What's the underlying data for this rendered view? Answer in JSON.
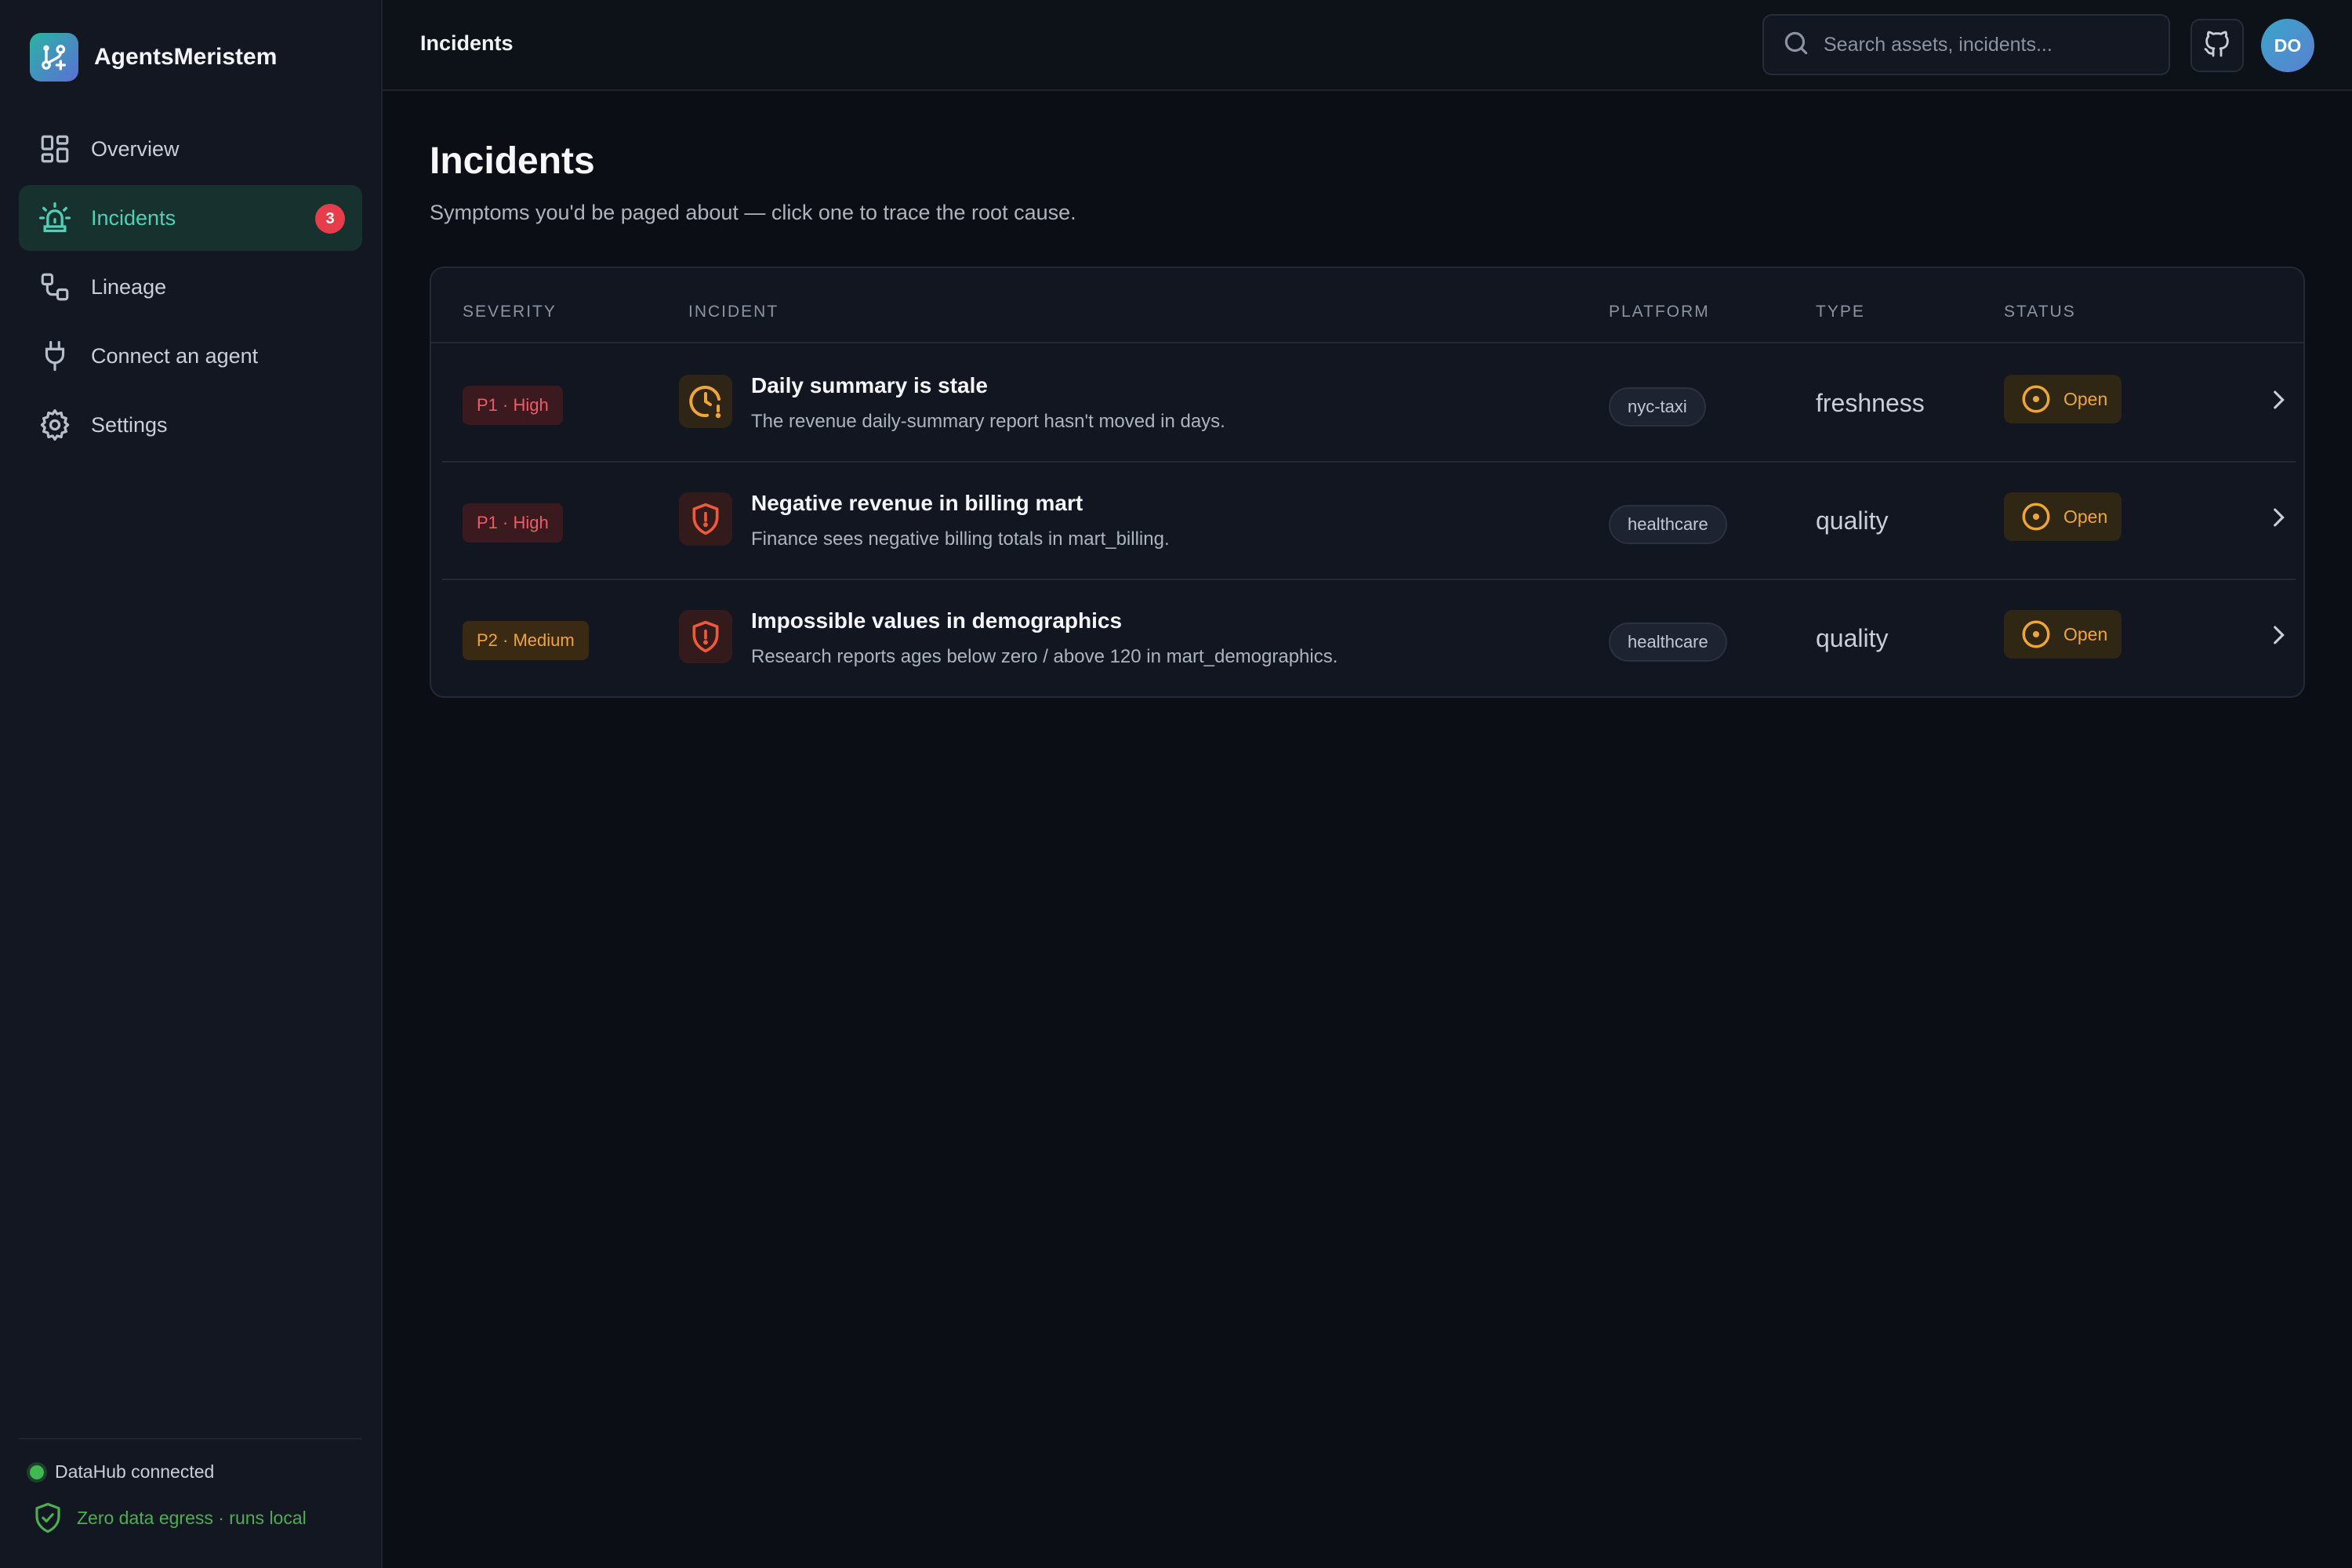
{
  "brand": {
    "name": "AgentsMeristem"
  },
  "sidebar": {
    "items": [
      {
        "label": "Overview",
        "icon": "grid-icon"
      },
      {
        "label": "Incidents",
        "icon": "siren-icon",
        "badge": "3",
        "active": true
      },
      {
        "label": "Lineage",
        "icon": "lineage-icon"
      },
      {
        "label": "Connect an agent",
        "icon": "plug-icon"
      },
      {
        "label": "Settings",
        "icon": "gear-icon"
      }
    ],
    "footer": {
      "connection": "DataHub connected",
      "egress": "Zero data egress · runs local"
    }
  },
  "topbar": {
    "title": "Incidents",
    "search_placeholder": "Search assets, incidents...",
    "avatar_initials": "DO"
  },
  "main": {
    "title": "Incidents",
    "subtitle": "Symptoms you'd be paged about — click one to trace the root cause."
  },
  "table": {
    "headers": {
      "severity": "SEVERITY",
      "incident": "INCIDENT",
      "platform": "PLATFORM",
      "type": "TYPE",
      "status": "STATUS"
    },
    "rows": [
      {
        "severity": "P1 · High",
        "title": "Daily summary is stale",
        "description": "The revenue daily-summary report hasn't moved in days.",
        "platform": "nyc-taxi",
        "type": "freshness",
        "status": "Open",
        "icon": "clock-alert-icon"
      },
      {
        "severity": "P1 · High",
        "title": "Negative revenue in billing mart",
        "description": "Finance sees negative billing totals in mart_billing.",
        "platform": "healthcare",
        "type": "quality",
        "status": "Open",
        "icon": "shield-alert-icon"
      },
      {
        "severity": "P2 · Medium",
        "title": "Impossible values in demographics",
        "description": "Research reports ages below zero / above 120 in mart_demographics.",
        "platform": "healthcare",
        "type": "quality",
        "status": "Open",
        "icon": "shield-alert-icon"
      }
    ]
  },
  "colors": {
    "accent": "#4fd1b8",
    "high": "#f05a67",
    "medium": "#f0a53a",
    "open": "#f0a53a",
    "connected": "#3fb950"
  }
}
